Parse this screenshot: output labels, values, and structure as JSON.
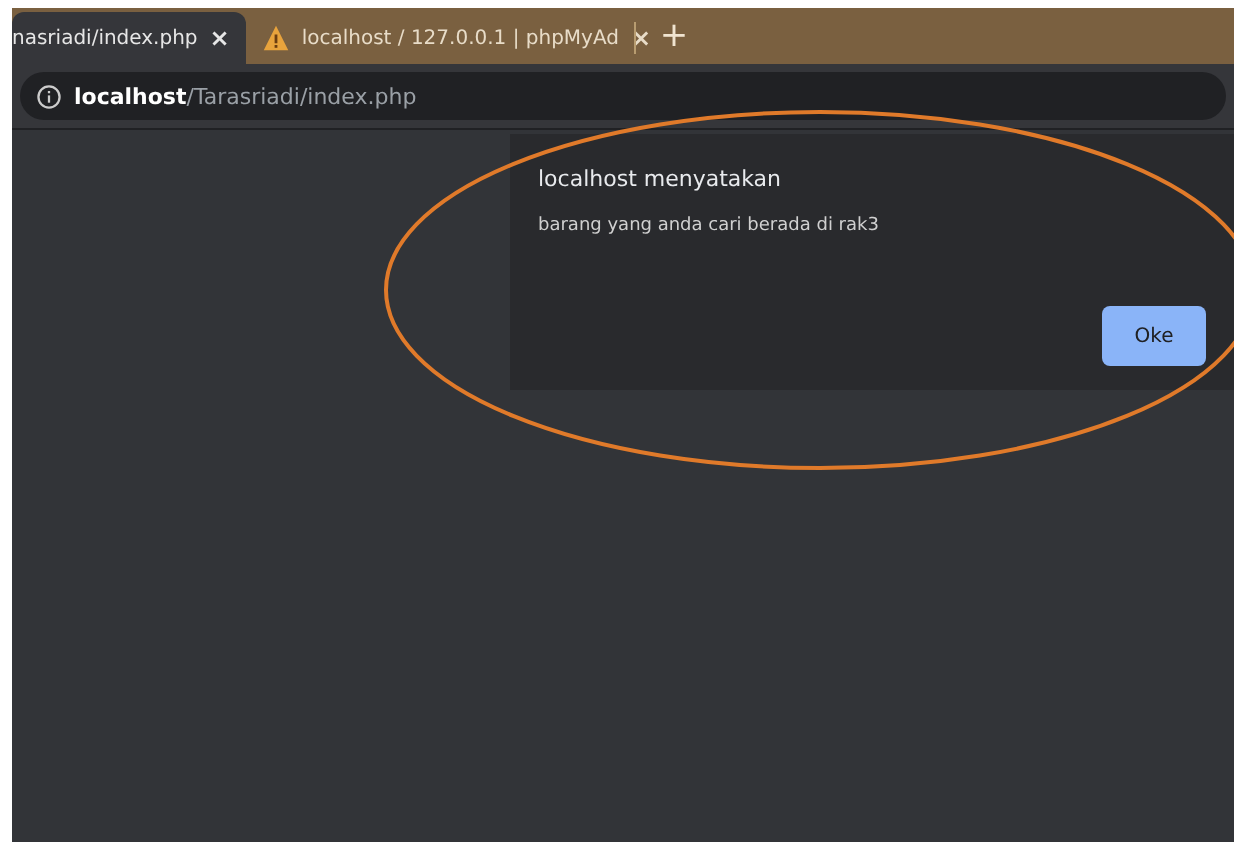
{
  "tabs": [
    {
      "kind": "plain",
      "title": "nasriadi/index.php",
      "close": "×",
      "selected": true
    },
    {
      "kind": "warning",
      "title": "localhost / 127.0.0.1 | phpMyAd",
      "close": "×",
      "selected": false
    }
  ],
  "new_tab": "+",
  "address_bar": {
    "host": "localhost",
    "path": "/Tarasriadi/index.php"
  },
  "dialog": {
    "title": "localhost menyatakan",
    "message": "barang yang anda cari berada di rak3",
    "button": "Oke"
  }
}
